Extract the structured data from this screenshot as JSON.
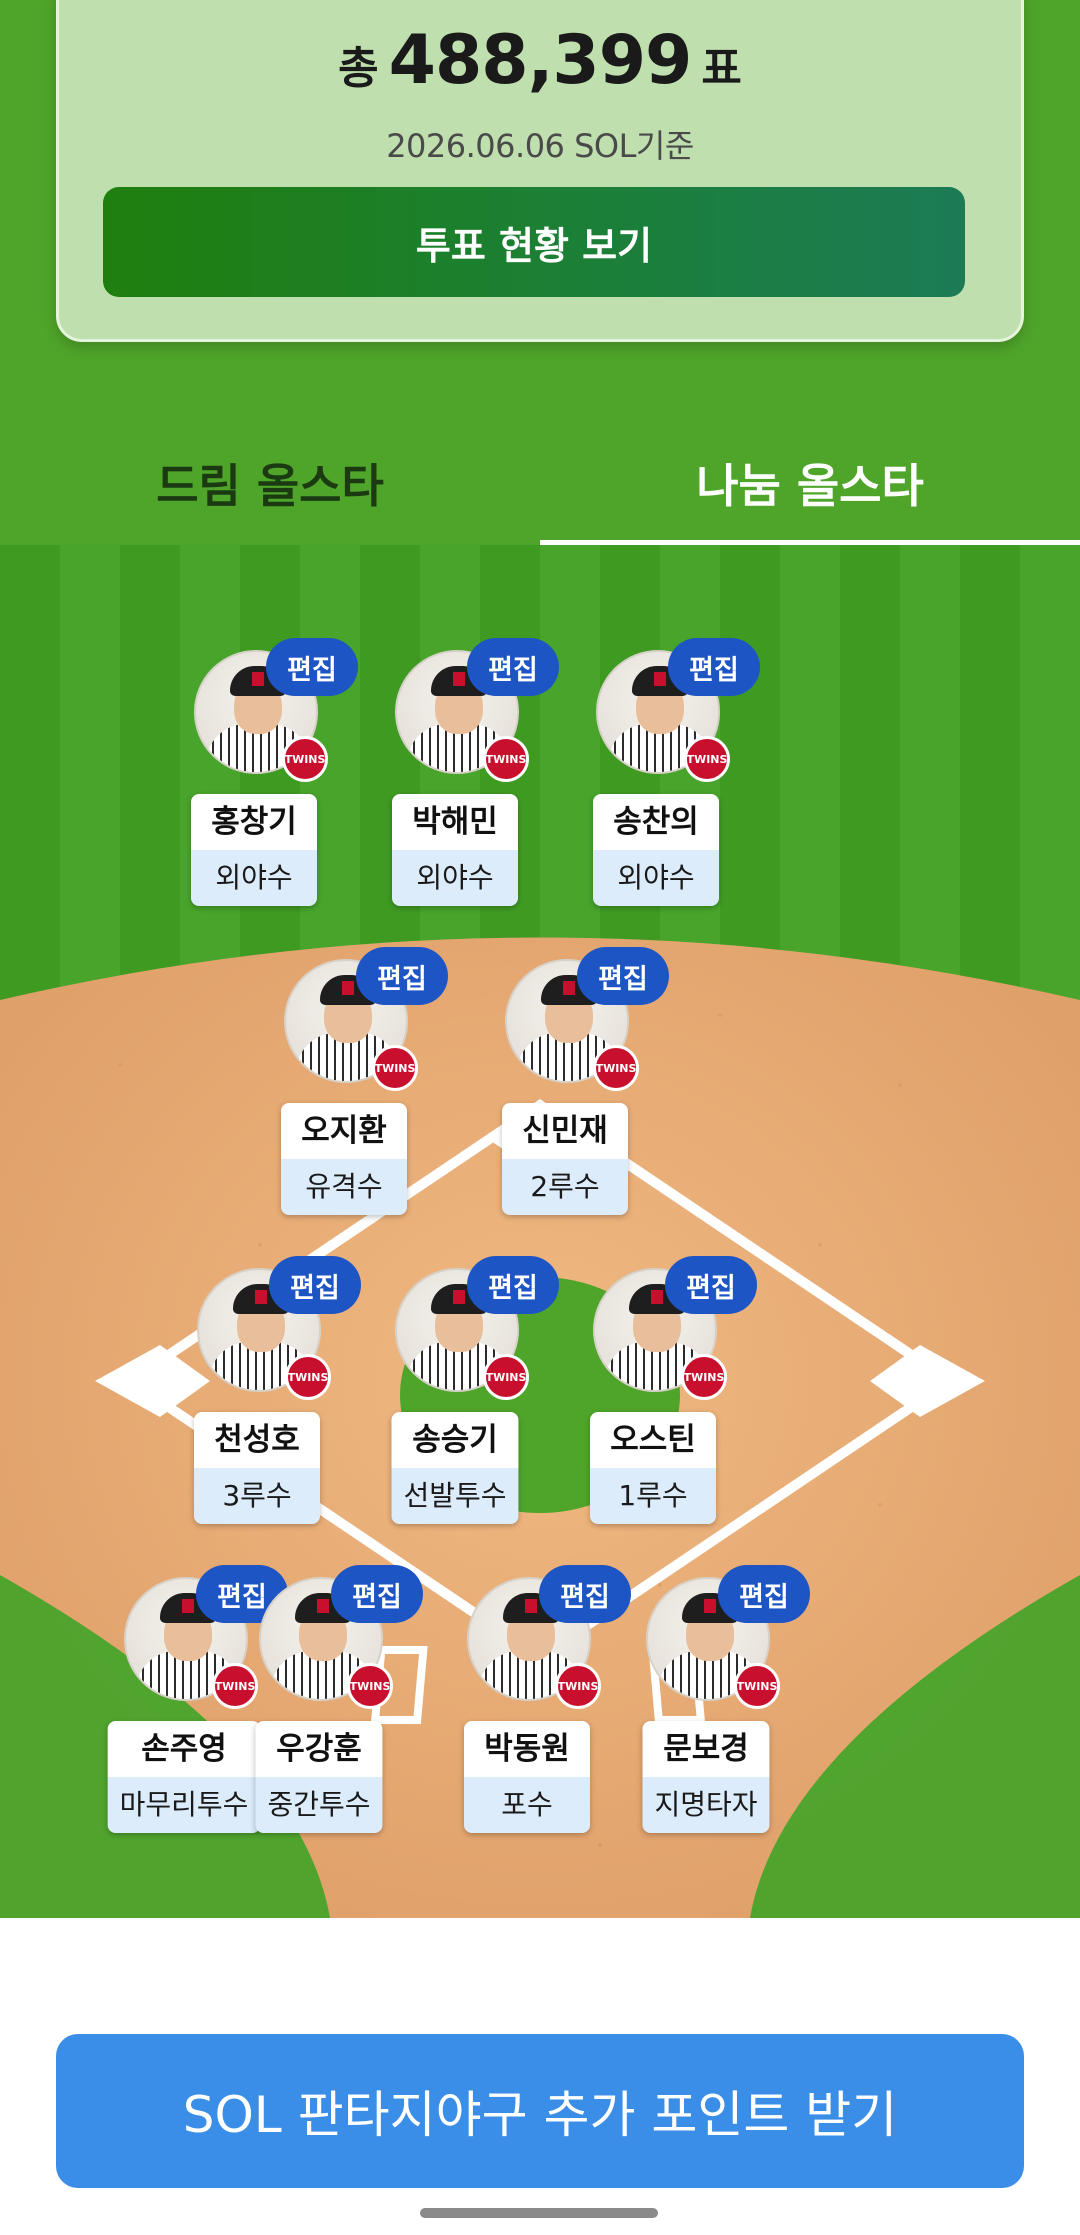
{
  "vote": {
    "prefix": "총",
    "total": "488,399",
    "suffix": "표",
    "date_label": "2026.06.06 SOL기준",
    "status_button_label": "투표 현황 보기"
  },
  "tabs": {
    "dream": "드림 올스타",
    "nanum": "나눔 올스타",
    "active": "nanum"
  },
  "edit_label": "편집",
  "team_badge": "TWINS",
  "players": [
    {
      "name": "홍창기",
      "position": "외야수"
    },
    {
      "name": "박해민",
      "position": "외야수"
    },
    {
      "name": "송찬의",
      "position": "외야수"
    },
    {
      "name": "오지환",
      "position": "유격수"
    },
    {
      "name": "신민재",
      "position": "2루수"
    },
    {
      "name": "천성호",
      "position": "3루수"
    },
    {
      "name": "송승기",
      "position": "선발투수"
    },
    {
      "name": "오스틴",
      "position": "1루수"
    },
    {
      "name": "손주영",
      "position": "마무리투수"
    },
    {
      "name": "우강훈",
      "position": "중간투수"
    },
    {
      "name": "박동원",
      "position": "포수"
    },
    {
      "name": "문보경",
      "position": "지명타자"
    }
  ],
  "bottom_button_label": "SOL 판타지야구 추가 포인트 받기",
  "colors": {
    "field_green": "#48a42b",
    "infield_dirt": "#e8ad72",
    "edit_blue": "#1e55c4",
    "cta_blue": "#3a8ee8",
    "vote_button_green": "#1f7f0e"
  }
}
